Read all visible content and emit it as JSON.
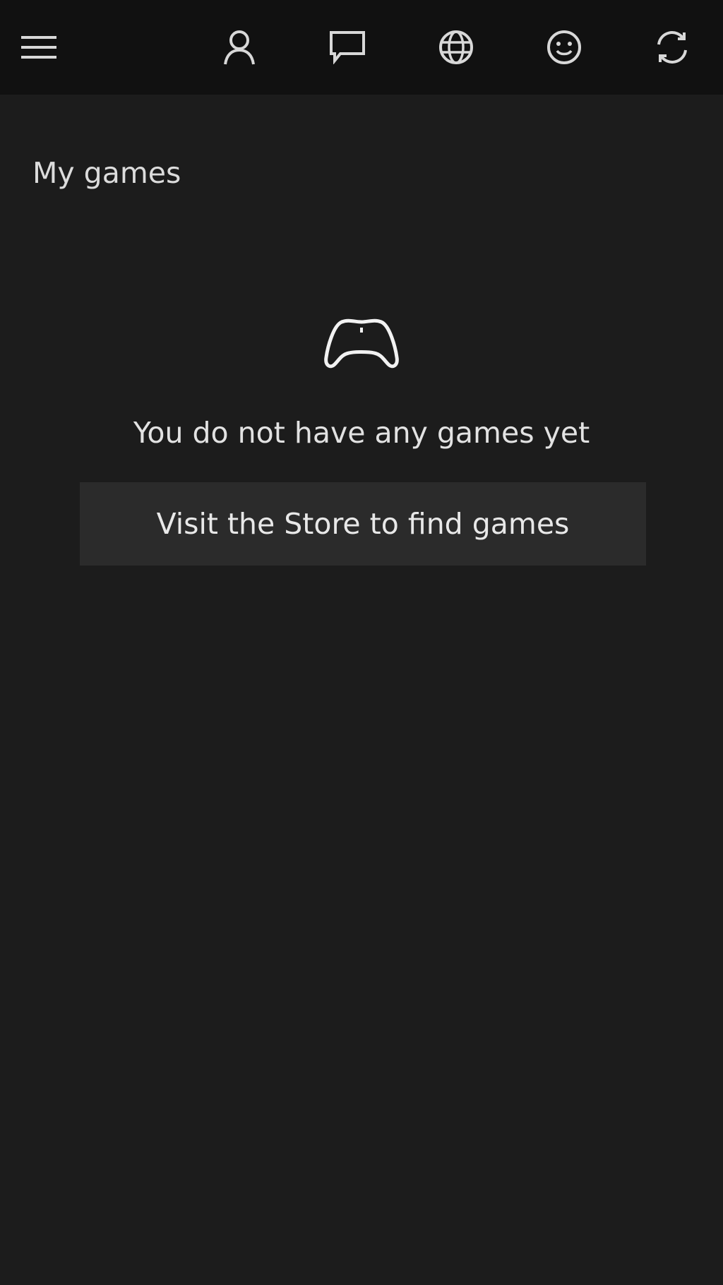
{
  "header": {
    "menu_icon": "hamburger-menu-icon",
    "buttons": [
      {
        "icon": "person-icon"
      },
      {
        "icon": "chat-bubble-icon"
      },
      {
        "icon": "globe-icon"
      },
      {
        "icon": "smiley-icon"
      },
      {
        "icon": "sync-icon"
      }
    ]
  },
  "page": {
    "title": "My games"
  },
  "empty_state": {
    "icon": "game-controller-icon",
    "message": "You do not have any games yet",
    "store_button_label": "Visit the Store to find games"
  },
  "colors": {
    "background": "#1c1c1c",
    "topbar": "#111111",
    "button": "#2b2b2b",
    "text": "#e6e6e6"
  }
}
